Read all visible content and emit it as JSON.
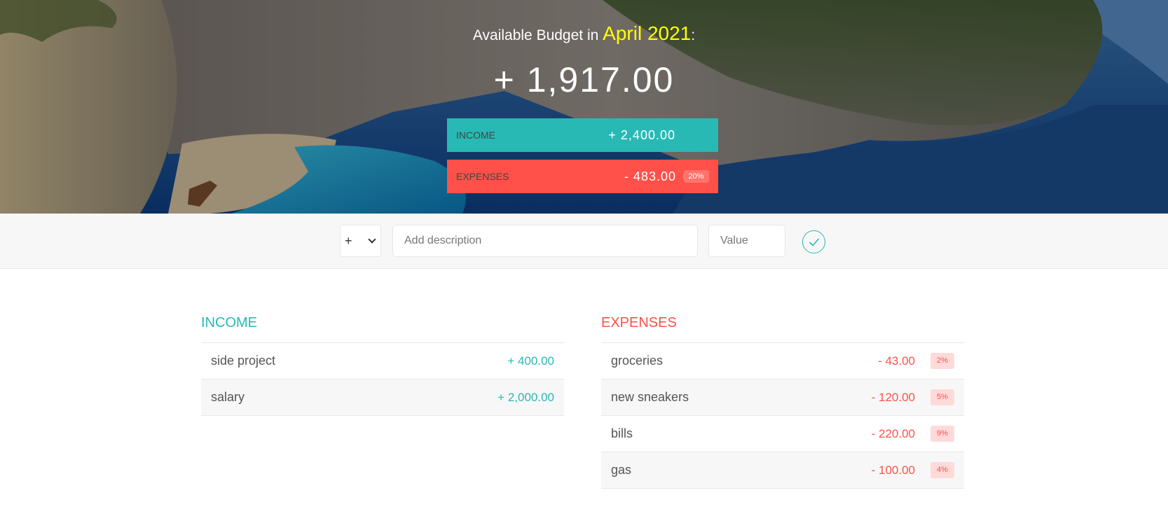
{
  "header": {
    "title_prefix": "Available Budget in",
    "month": "April 2021",
    "title_suffix": ":",
    "available_budget": "+ 1,917.00",
    "income_label": "Income",
    "income_value": "+ 2,400.00",
    "expenses_label": "Expenses",
    "expenses_value": "- 483.00",
    "expenses_percentage": "20%"
  },
  "add_form": {
    "type_value": "+",
    "description_placeholder": "Add description",
    "value_placeholder": "Value"
  },
  "income": {
    "title": "Income",
    "items": [
      {
        "description": "side project",
        "value": "+ 400.00"
      },
      {
        "description": "salary",
        "value": "+ 2,000.00"
      }
    ]
  },
  "expenses": {
    "title": "Expenses",
    "items": [
      {
        "description": "groceries",
        "value": "- 43.00",
        "percentage": "2%"
      },
      {
        "description": "new sneakers",
        "value": "- 120.00",
        "percentage": "5%"
      },
      {
        "description": "bills",
        "value": "- 220.00",
        "percentage": "9%"
      },
      {
        "description": "gas",
        "value": "- 100.00",
        "percentage": "4%"
      }
    ]
  },
  "colors": {
    "income": "#28b9b5",
    "expenses": "#ff5049",
    "month_highlight": "#ffff00"
  }
}
